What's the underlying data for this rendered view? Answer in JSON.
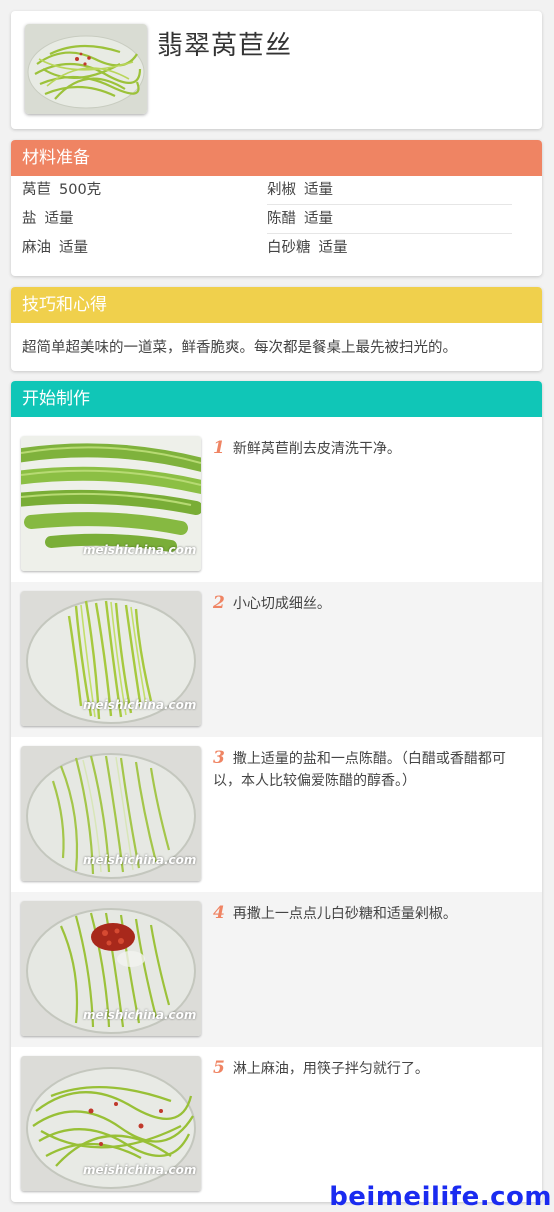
{
  "recipe": {
    "title": "翡翠莴苣丝"
  },
  "ingredients": {
    "heading": "材料准备",
    "rows": [
      {
        "left": {
          "name": "莴苣",
          "amount": "500克"
        },
        "right": {
          "name": "剁椒",
          "amount": "适量"
        }
      },
      {
        "left": {
          "name": "盐",
          "amount": "适量"
        },
        "right": {
          "name": "陈醋",
          "amount": "适量"
        }
      },
      {
        "left": {
          "name": "麻油",
          "amount": "适量"
        },
        "right": {
          "name": "白砂糖",
          "amount": "适量"
        }
      }
    ]
  },
  "tips": {
    "heading": "技巧和心得",
    "text": "超简单超美味的一道菜，鲜香脆爽。每次都是餐桌上最先被扫光的。"
  },
  "steps": {
    "heading": "开始制作",
    "watermark": "meishichina.com",
    "items": [
      {
        "num": "1",
        "text": "新鲜莴苣削去皮清洗干净。"
      },
      {
        "num": "2",
        "text": "小心切成细丝。"
      },
      {
        "num": "3",
        "text": "撒上适量的盐和一点陈醋。（白醋或香醋都可以，本人比较偏爱陈醋的醇香。）"
      },
      {
        "num": "4",
        "text": "再撒上一点点儿白砂糖和适量剁椒。"
      },
      {
        "num": "5",
        "text": "淋上麻油，用筷子拌匀就行了。"
      }
    ]
  },
  "footer": {
    "brand": "beimeilife.com"
  },
  "colors": {
    "ingredients_header": "#ef8463",
    "tips_header": "#f0d04c",
    "steps_header": "#10c6b7",
    "step_number": "#ef8463",
    "brand": "#1a2bf0"
  }
}
